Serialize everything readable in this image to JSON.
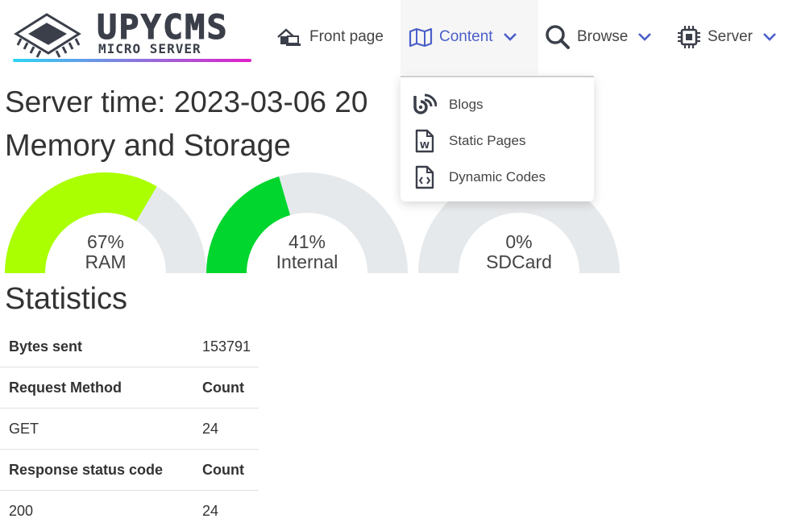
{
  "logo": {
    "title": "UPYCMS",
    "subtitle": "MICRO SERVER"
  },
  "nav": {
    "front_page": "Front page",
    "content": "Content",
    "browse": "Browse",
    "server": "Server"
  },
  "dropdown": {
    "items": [
      {
        "label": "Blogs",
        "icon": "blog-icon"
      },
      {
        "label": "Static Pages",
        "icon": "file-word-icon"
      },
      {
        "label": "Dynamic Codes",
        "icon": "file-code-icon"
      }
    ]
  },
  "server_time": "Server time: 2023-03-06 20",
  "memory_title": "Memory and Storage",
  "gauges": [
    {
      "value": "67%",
      "label": "RAM",
      "fraction": 0.67,
      "color": "#aaff00"
    },
    {
      "value": "41%",
      "label": "Internal",
      "fraction": 0.41,
      "color": "#00d62e"
    },
    {
      "value": "0%",
      "label": "SDCard",
      "fraction": 0.0,
      "color": "#00d62e"
    }
  ],
  "statistics_title": "Statistics",
  "stats": {
    "bytes_sent_label": "Bytes sent",
    "bytes_sent_value": "153791",
    "request_method_header": "Request Method",
    "count_header_1": "Count",
    "get_label": "GET",
    "get_count": "24",
    "response_status_header": "Response status code",
    "count_header_2": "Count",
    "status_200": "200",
    "status_200_count": "24"
  },
  "colors": {
    "accent": "#4b5fc9",
    "gauge_track": "#e6e9eb",
    "logo_gradient_start": "#2dd4f5",
    "logo_gradient_end": "#e21ec8"
  }
}
